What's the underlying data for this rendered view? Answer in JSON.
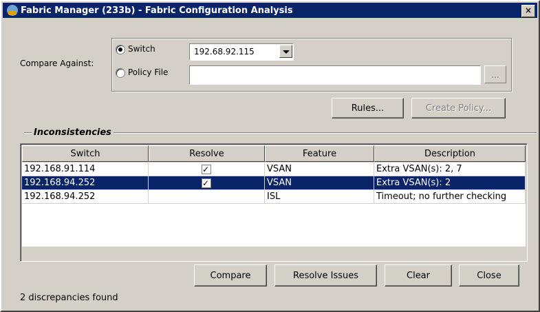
{
  "window": {
    "title": "Fabric Manager (233b) - Fabric Configuration Analysis",
    "close_glyph": "×"
  },
  "compare": {
    "label": "Compare Against:",
    "switch_label": "Switch",
    "switch_selected": true,
    "switch_value": "192.68.92.115",
    "policy_label": "Policy File",
    "policy_value": "",
    "browse_label": "..."
  },
  "actions": {
    "rules": "Rules...",
    "create_policy": "Create Policy..."
  },
  "inconsistencies": {
    "section_title": "Inconsistencies",
    "columns": [
      "Switch",
      "Resolve",
      "Feature",
      "Description"
    ],
    "rows": [
      {
        "switch": "192.168.91.114",
        "resolve": true,
        "feature": "VSAN",
        "description": "Extra VSAN(s): 2, 7",
        "selected": false
      },
      {
        "switch": "192.168.94.252",
        "resolve": true,
        "feature": "VSAN",
        "description": "Extra VSAN(s): 2",
        "selected": true
      },
      {
        "switch": "192.168.94.252",
        "resolve": null,
        "feature": "ISL",
        "description": "Timeout; no further checking",
        "selected": false
      }
    ]
  },
  "footer": {
    "compare": "Compare",
    "resolve_issues": "Resolve Issues",
    "clear": "Clear",
    "close": "Close",
    "status": "2 discrepancies found"
  },
  "colors": {
    "titlebar": "#0a246a",
    "selection": "#0a246a",
    "dialog": "#d4d0c8"
  }
}
